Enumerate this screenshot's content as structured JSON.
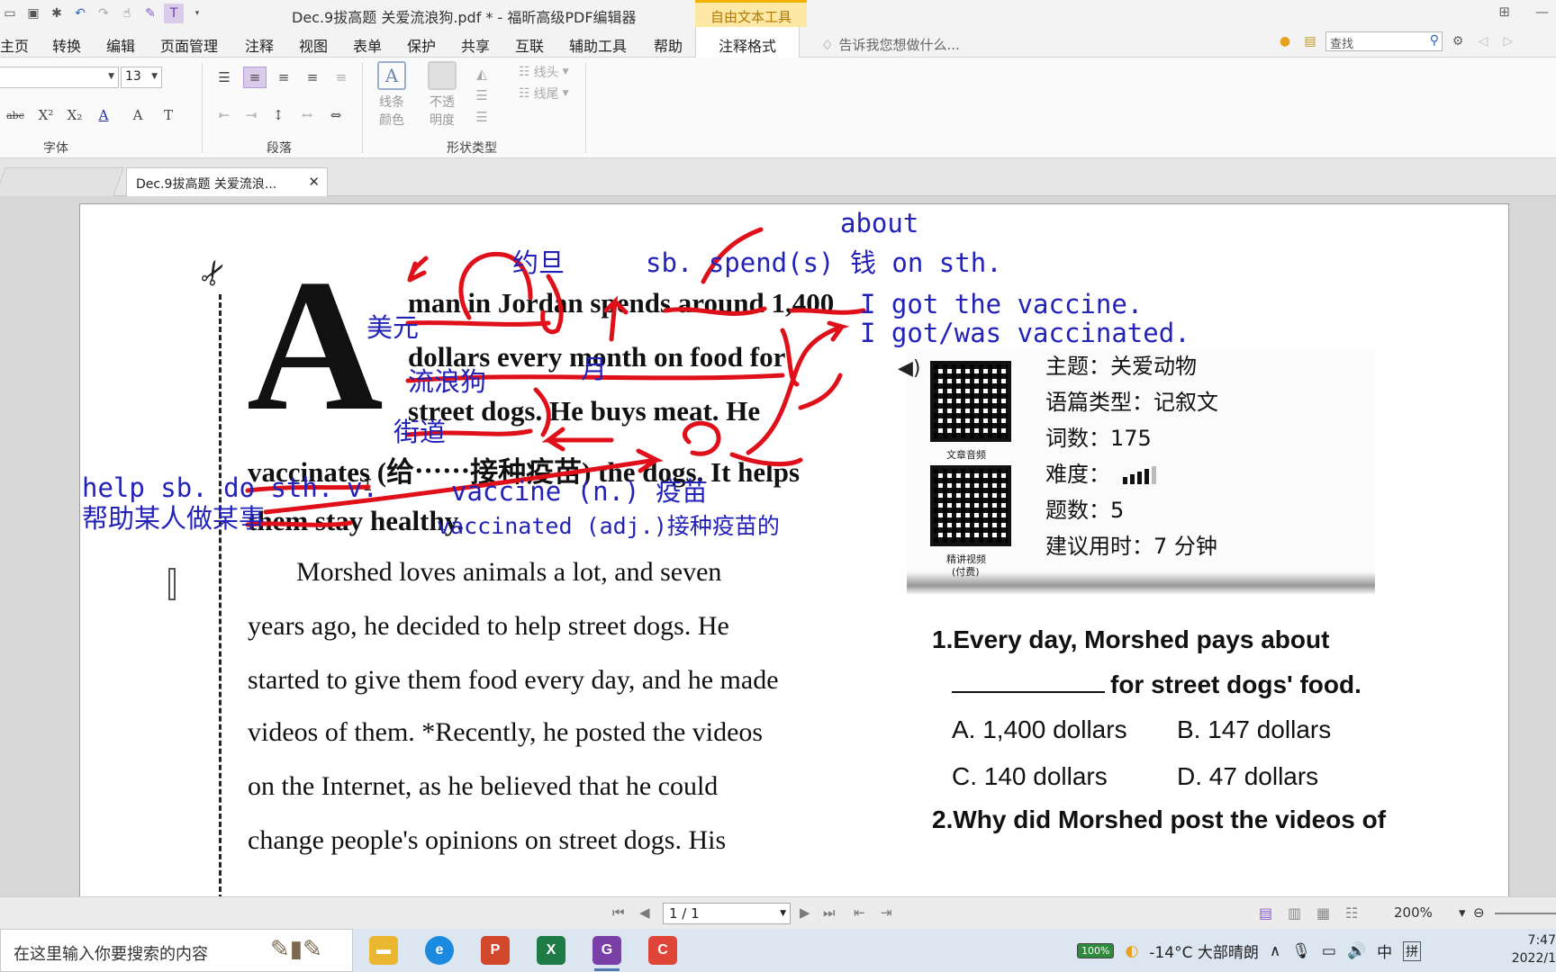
{
  "titlebar": {
    "title": "Dec.9拔高题 关爱流浪狗.pdf * - 福昕高级PDF编辑器",
    "context_tab_group": "自由文本工具"
  },
  "menubar": {
    "items": [
      "主页",
      "转换",
      "编辑",
      "页面管理",
      "注释",
      "视图",
      "表单",
      "保护",
      "共享",
      "互联",
      "辅助工具",
      "帮助"
    ],
    "active_tab": "注释格式",
    "tell_me": "告诉我您想做什么...",
    "search_placeholder": "查找"
  },
  "ribbon": {
    "font_size": "13",
    "groups": {
      "font": "字体",
      "paragraph": "段落",
      "shape_type": "形状类型"
    },
    "line_color_label_1": "线条",
    "line_color_label_2": "颜色",
    "opacity_label_1": "不透",
    "opacity_label_2": "明度",
    "line_start": "线头",
    "line_end": "线尾"
  },
  "document_tab": {
    "label": "Dec.9拔高题 关爱流浪..."
  },
  "page": {
    "dropcap": "A",
    "lines": [
      "man in Jordan spends around 1,400",
      "dollars every month on food for",
      "street dogs. He buys meat. He",
      "vaccinates (给⋯⋯接种疫苗) the dogs. It helps",
      "them stay healthy.",
      "Morshed loves animals a lot, and seven",
      "years ago, he decided to help street dogs. He",
      "started to give them food every day, and he made",
      "videos of them. *Recently, he posted the videos",
      "on the Internet, as he believed that he could",
      "change people's opinions on street dogs. His"
    ],
    "annotations": {
      "about": "about",
      "yuedan": "约旦",
      "spend_pattern": "sb. spend(s) 钱 on sth.",
      "meiyuan": "美元",
      "liulanggou": "流浪狗",
      "yue": "月",
      "jiedao": "街道",
      "vaccine_sentence_1": "I got the vaccine.",
      "vaccine_sentence_2": "I got/was vaccinated.",
      "help_pattern": "help sb. do sth.",
      "v_mark": "v.",
      "help_meaning": "帮助某人做某事",
      "vaccine_noun": "vaccine (n.) 疫苗",
      "vaccinated_adj": "vaccinated (adj.)接种疫苗的"
    },
    "info_card": {
      "topic": "主题：关爱动物",
      "genre": "语篇类型：记叙文",
      "word_count": "词数：175",
      "difficulty": "难度：",
      "difficulty_level": 0.8,
      "question_count": "题数：5",
      "suggested_time": "建议用时：7 分钟",
      "qr1_caption": "文章音频",
      "qr2_caption_1": "精讲视频",
      "qr2_caption_2": "(付费)"
    },
    "questions": {
      "q1": "1.Every day, Morshed pays about",
      "q1_cont": "for street dogs' food.",
      "a": "A. 1,400 dollars",
      "b": "B. 147 dollars",
      "c": "C. 140 dollars",
      "d": "D. 47 dollars",
      "q2": "2.Why did Morshed post the videos of"
    }
  },
  "statusbar": {
    "page_indicator": "1 / 1",
    "zoom": "200%"
  },
  "taskbar": {
    "search_placeholder": "在这里输入你要搜索的内容",
    "battery": "100%",
    "weather": "-14°C  大部晴朗",
    "ime_1": "中",
    "ime_2": "拼",
    "time": "7:47",
    "date": "2022/1"
  },
  "colors": {
    "annotation_blue": "#2222b8",
    "annotation_red": "#e0101a",
    "accent_purple": "#8a5cc2",
    "context_tab": "#fde8a6"
  }
}
